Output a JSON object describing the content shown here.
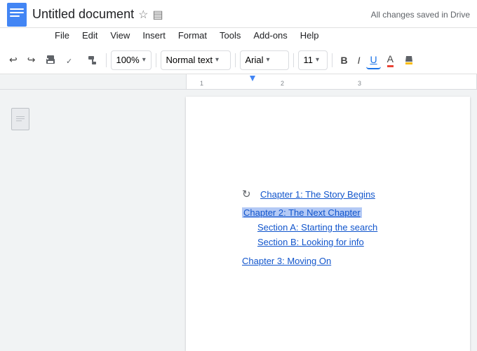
{
  "titleBar": {
    "docTitle": "Untitled document",
    "savedStatus": "All changes saved in Drive",
    "starIcon": "☆",
    "driveIcon": "▤"
  },
  "menuBar": {
    "items": [
      "File",
      "Edit",
      "View",
      "Insert",
      "Format",
      "Tools",
      "Add-ons",
      "Help"
    ]
  },
  "toolbar": {
    "undoLabel": "↩",
    "redoLabel": "↪",
    "printLabel": "🖨",
    "spellLabel": "✓",
    "paintLabel": "🎨",
    "zoomValue": "100%",
    "zoomChevron": "▾",
    "styleValue": "Normal text",
    "styleChevron": "▾",
    "fontValue": "Arial",
    "fontChevron": "▾",
    "sizeValue": "11",
    "sizeChevron": "▾",
    "boldLabel": "B",
    "italicLabel": "I",
    "underlineLabel": "U",
    "fontColorLabel": "A",
    "highlightLabel": "✏"
  },
  "toc": {
    "refreshIcon": "↻",
    "items": [
      {
        "label": "Chapter 1: The Story Begins",
        "level": "chapter",
        "selected": false
      },
      {
        "label": "Chapter 2: The Next Chapter",
        "level": "chapter",
        "selected": true
      },
      {
        "label": "Section A: Starting the search",
        "level": "section",
        "selected": false
      },
      {
        "label": "Section B: Looking for info",
        "level": "section",
        "selected": false
      },
      {
        "label": "Chapter 3: Moving On",
        "level": "chapter",
        "selected": false
      }
    ]
  }
}
